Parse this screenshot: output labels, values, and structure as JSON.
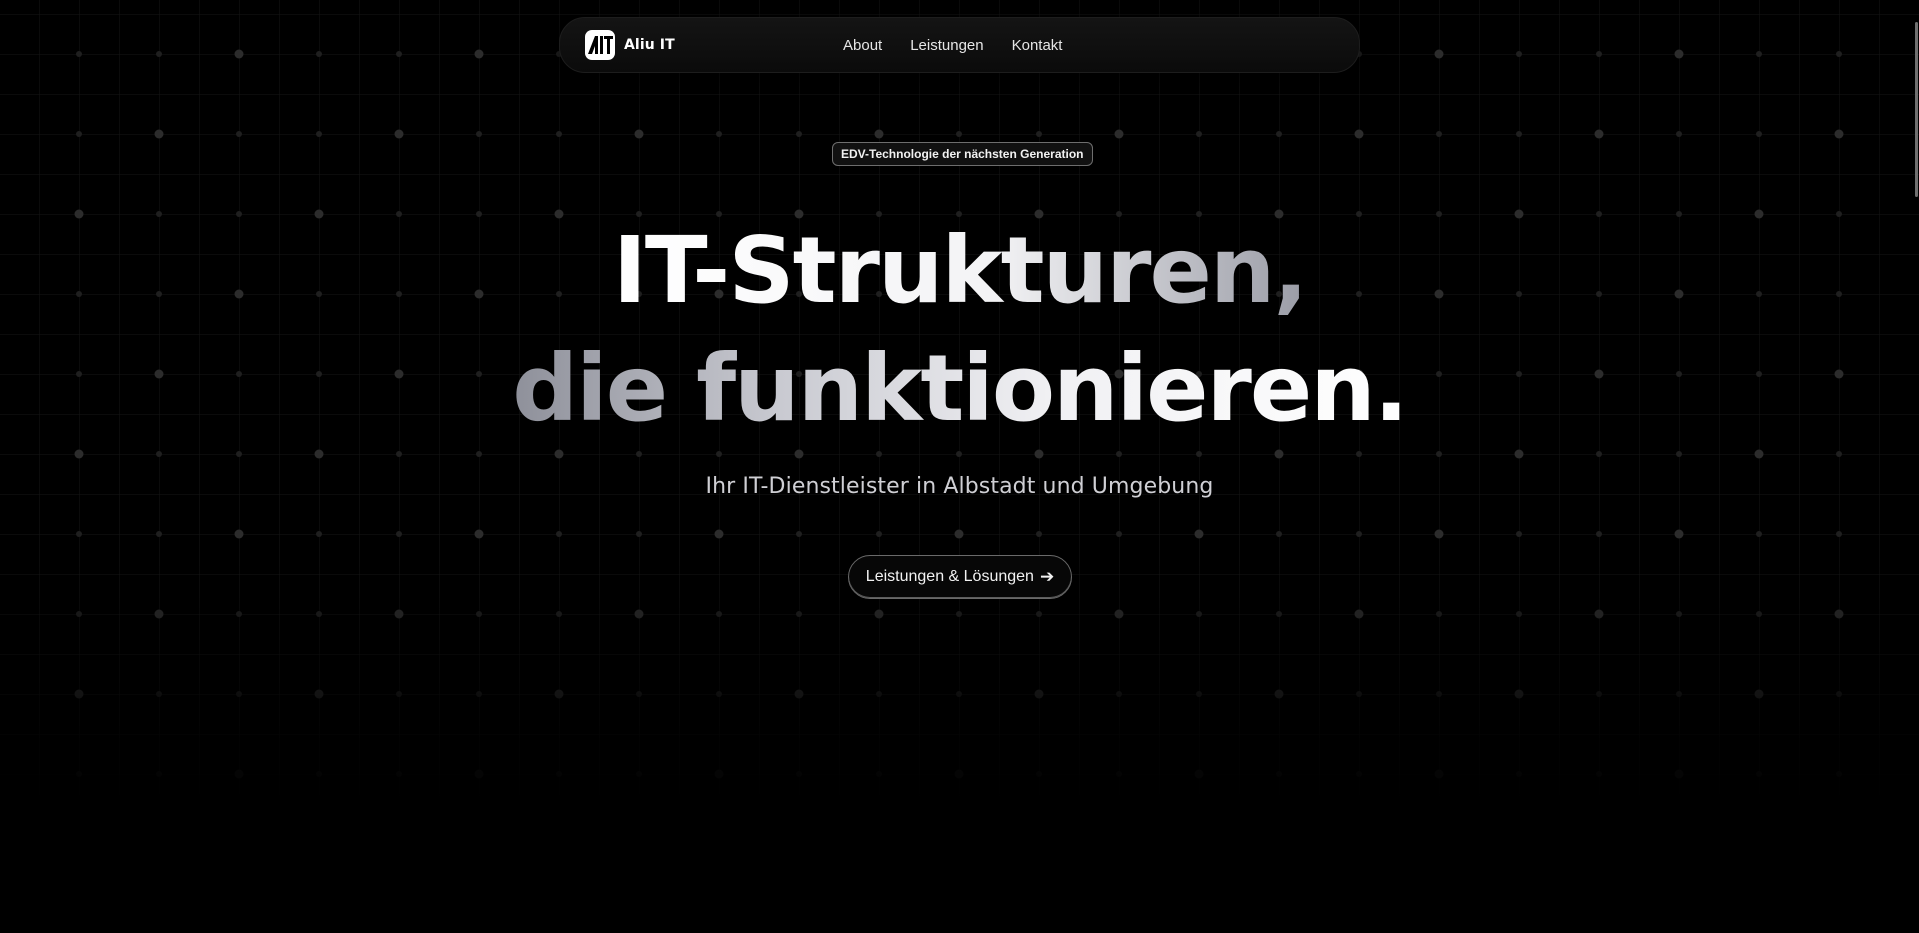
{
  "brand": {
    "logo_text": "AIT",
    "name": "Aliu IT"
  },
  "nav": {
    "items": [
      "About",
      "Leistungen",
      "Kontakt"
    ]
  },
  "hero": {
    "badge": "EDV-Technologie der nächsten Generation",
    "headline_line1": "IT-Strukturen,",
    "headline_line2": "die funktionieren.",
    "subtitle": "Ihr IT-Dienstleister in Albstadt und Umgebung",
    "cta_label": "Leistungen & Lösungen",
    "cta_icon": "arrow-right-icon",
    "cta_arrow": "➔"
  },
  "colors": {
    "background": "#000000",
    "text": "#ffffff",
    "subtitle": "#cfcfd4",
    "border": "#6e6e6e"
  }
}
